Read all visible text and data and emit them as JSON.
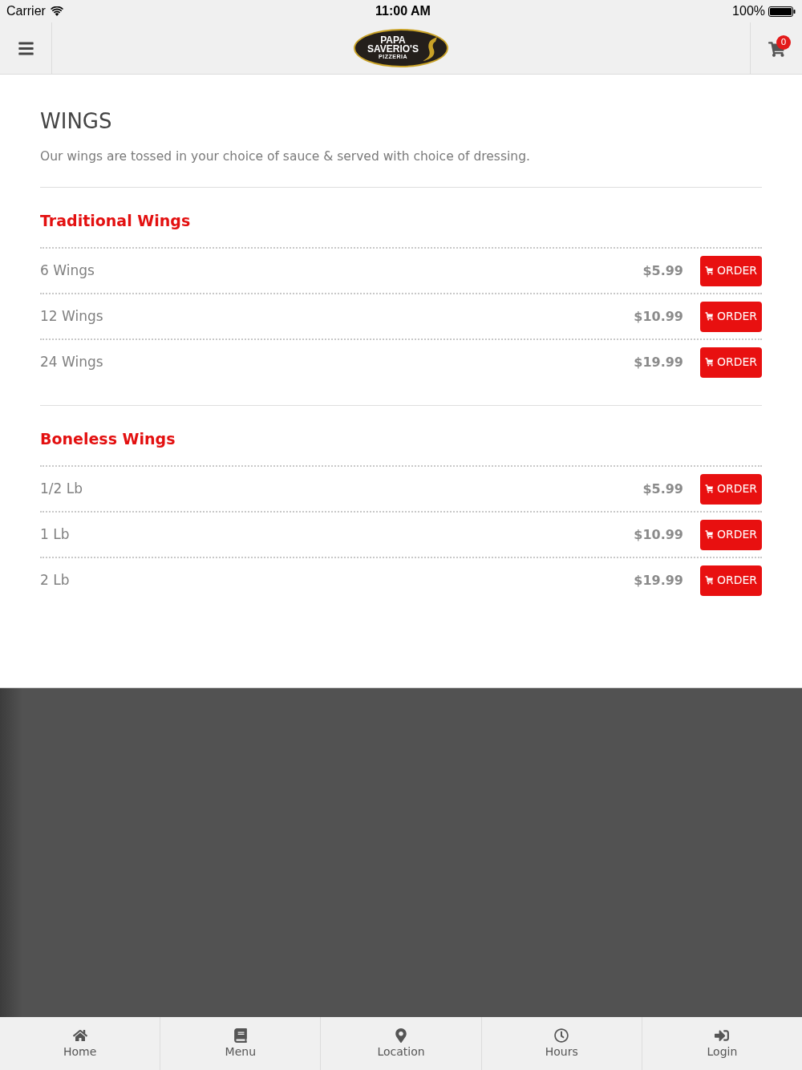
{
  "status_bar": {
    "carrier": "Carrier",
    "time": "11:00 AM",
    "battery": "100%"
  },
  "nav_bar": {
    "logo_lines": [
      "PAPA",
      "SAVERIO'S",
      "PIZZERIA"
    ],
    "cart_count": "0"
  },
  "page": {
    "title": "WINGS",
    "description": "Our wings are tossed in your choice of sauce & served with choice of dressing."
  },
  "sections": [
    {
      "title": "Traditional Wings",
      "items": [
        {
          "name": "6 Wings",
          "price": "$5.99",
          "button": "ORDER"
        },
        {
          "name": "12 Wings",
          "price": "$10.99",
          "button": "ORDER"
        },
        {
          "name": "24 Wings",
          "price": "$19.99",
          "button": "ORDER"
        }
      ]
    },
    {
      "title": "Boneless Wings",
      "items": [
        {
          "name": "1/2 Lb",
          "price": "$5.99",
          "button": "ORDER"
        },
        {
          "name": "1 Lb",
          "price": "$10.99",
          "button": "ORDER"
        },
        {
          "name": "2 Lb",
          "price": "$19.99",
          "button": "ORDER"
        }
      ]
    }
  ],
  "tab_bar": [
    {
      "label": "Home"
    },
    {
      "label": "Menu"
    },
    {
      "label": "Location"
    },
    {
      "label": "Hours"
    },
    {
      "label": "Login"
    }
  ]
}
